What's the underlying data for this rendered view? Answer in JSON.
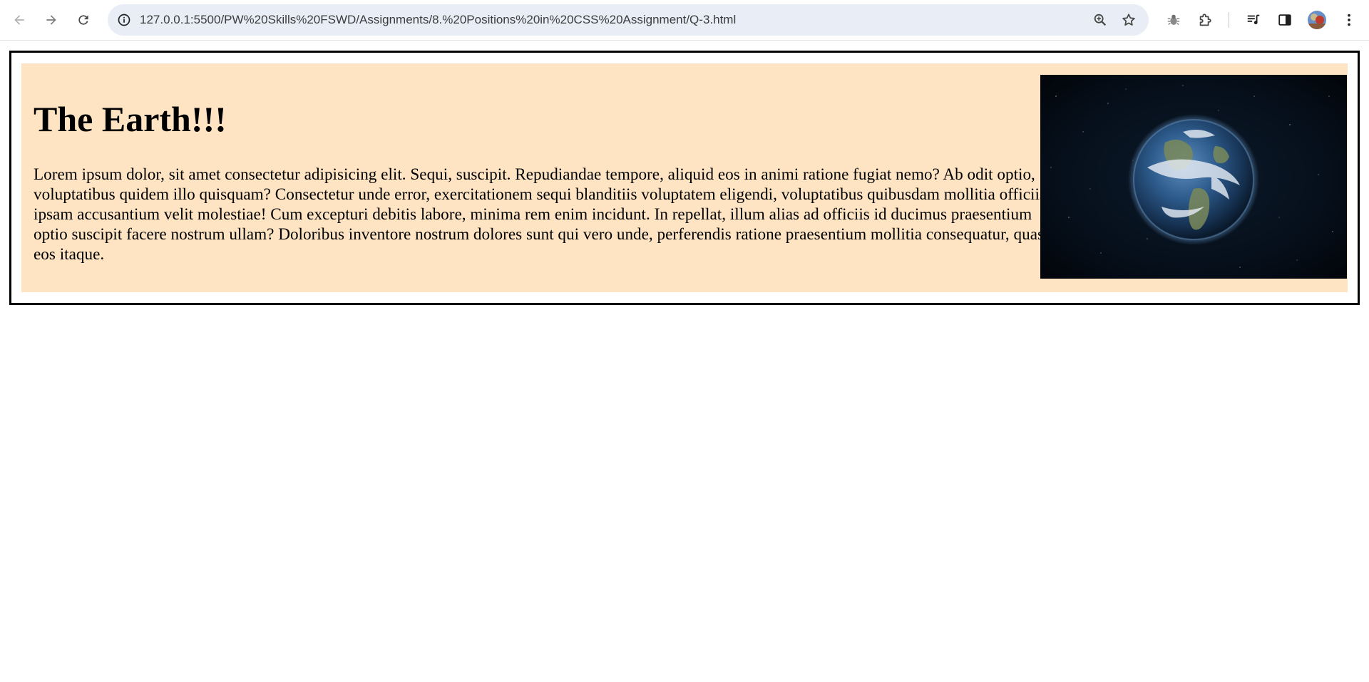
{
  "browser": {
    "url": "127.0.0.1:5500/PW%20Skills%20FSWD/Assignments/8.%20Positions%20in%20CSS%20Assignment/Q-3.html",
    "icons": [
      "back-arrow",
      "forward-arrow",
      "reload",
      "site-info",
      "zoom",
      "bookmark-star",
      "bug",
      "extensions-puzzle",
      "media-control",
      "side-panel",
      "profile-avatar",
      "kebab-menu"
    ]
  },
  "page": {
    "title": "The Earth!!!",
    "body": "Lorem ipsum dolor, sit amet consectetur adipisicing elit. Sequi, suscipit. Repudiandae tempore, aliquid eos in animi ratione fugiat nemo? Ab odit optio, voluptatibus quidem illo quisquam? Consectetur unde error, exercitationem sequi blanditiis voluptatem eligendi, voluptatibus quibusdam mollitia officiis, ipsam accusantium velit molestiae! Cum excepturi debitis labore, minima rem enim incidunt. In repellat, illum alias ad officiis id ducimus praesentium optio suscipit facere nostrum ullam? Doloribus inventore nostrum dolores sunt qui vero unde, perferendis ratione praesentium mollitia consequatur, quas eos itaque.",
    "image": "earth-from-space",
    "colors": {
      "card_background": "#ffe4c4",
      "border": "#000000"
    }
  }
}
